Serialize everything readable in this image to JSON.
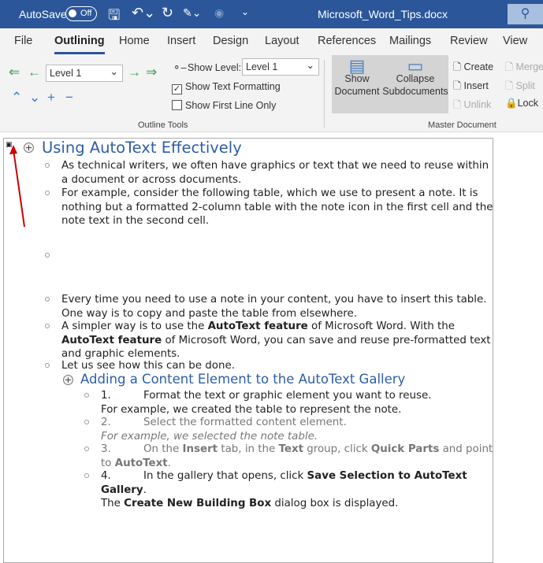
{
  "titlebar": {
    "autosave": "AutoSave",
    "toggle": "Off",
    "filename": "Microsoft_Word_Tips.docx"
  },
  "tabs": [
    "File",
    "Outlining",
    "Home",
    "Insert",
    "Design",
    "Layout",
    "References",
    "Mailings",
    "Review",
    "View"
  ],
  "ribbon": {
    "level_value": "Level 1",
    "show_level_label": "Show Level:",
    "show_level_value": "Level 1",
    "show_text_formatting": "Show Text Formatting",
    "show_first_line": "Show First Line Only",
    "outline_tools": "Outline Tools",
    "show_document": "Show Document",
    "collapse_sub": "Collapse Subdocuments",
    "create": "Create",
    "insert": "Insert",
    "unlink": "Unlink",
    "merge": "Merge",
    "split": "Split",
    "lock": "Lock",
    "master_document": "Master Document"
  },
  "doc": {
    "heading1": "Using AutoText Effectively",
    "heading2": "Adding a Content Element to the AutoText Gallery",
    "paras": [
      {
        "runs": [
          {
            "t": "As technical writers, we often have graphics or text that we need to reuse within a document or across documents."
          }
        ]
      },
      {
        "runs": [
          {
            "t": "For example, consider the following table, which we use to present a note. It is nothing but a formatted 2-column table with the note icon in the first cell and the note text in the second cell."
          }
        ]
      },
      {
        "runs": []
      },
      {
        "runs": [
          {
            "t": "Every time you need to use a note in your content, you have to insert this table. One way is to copy and paste the table from elsewhere."
          }
        ]
      },
      {
        "runs": [
          {
            "t": "A simpler way is to use the "
          },
          {
            "t": "AutoText feature",
            "b": true
          },
          {
            "t": " of Microsoft Word. With the "
          },
          {
            "t": "AutoText feature",
            "b": true
          },
          {
            "t": " of Microsoft Word, you can save and reuse pre-formatted text and graphic elements."
          }
        ]
      },
      {
        "runs": [
          {
            "t": "Let us see how this can be done."
          }
        ]
      }
    ],
    "steps": [
      {
        "num": "1.",
        "runs": [
          {
            "t": "Format the text or graphic element you want to reuse."
          }
        ],
        "extra": [
          {
            "t": "For example, we created the table to represent the note."
          }
        ]
      },
      {
        "num": "2.",
        "gray": true,
        "runs": [
          {
            "t": "Select the formatted content element."
          }
        ],
        "extra": [
          {
            "t": "For example, we selected the note table.",
            "i": true
          }
        ]
      },
      {
        "num": "3.",
        "gray": true,
        "runs": [
          {
            "t": "On the "
          },
          {
            "t": "Insert",
            "b": true
          },
          {
            "t": " tab, in the "
          },
          {
            "t": "Text",
            "b": true
          },
          {
            "t": " group, click "
          },
          {
            "t": "Quick Parts",
            "b": true
          },
          {
            "t": " and point to "
          },
          {
            "t": "AutoText",
            "b": true
          },
          {
            "t": "."
          }
        ]
      },
      {
        "num": "4.",
        "runs": [
          {
            "t": "In the gallery that opens, click "
          },
          {
            "t": "Save Selection to AutoText Gallery",
            "b": true
          },
          {
            "t": "."
          }
        ],
        "extra": [
          {
            "t": "The "
          },
          {
            "t": "Create New Building Box",
            "b": true
          },
          {
            "t": " dialog box is displayed."
          }
        ]
      }
    ]
  }
}
